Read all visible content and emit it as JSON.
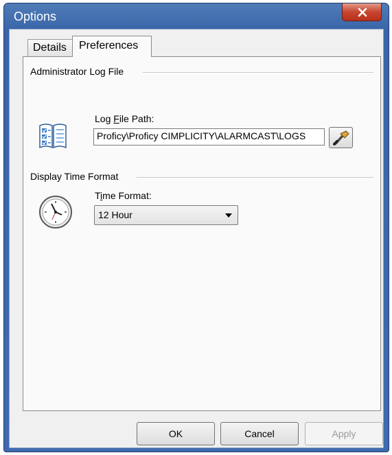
{
  "window": {
    "title": "Options"
  },
  "tabs": [
    {
      "label": "Details"
    },
    {
      "label": "Preferences",
      "selected": true
    }
  ],
  "log_group": {
    "heading": "Administrator Log File",
    "field_label_pre": "Log ",
    "field_label_u": "F",
    "field_label_post": "ile Path:",
    "path_value": "Proficy\\Proficy CIMPLICITY\\ALARMCAST\\LOGS",
    "icon": "log-book-icon",
    "browse_icon": "wrench-icon"
  },
  "time_group": {
    "heading": "Display Time Format",
    "field_label_pre": "T",
    "field_label_u": "i",
    "field_label_post": "me Format:",
    "selected_value": "12 Hour",
    "icon": "clock-icon"
  },
  "buttons": {
    "ok": "OK",
    "cancel": "Cancel",
    "apply": "Apply"
  },
  "colors": {
    "titlebar": "#3f6aae",
    "close": "#c8452f",
    "client": "#f0f0f0"
  }
}
